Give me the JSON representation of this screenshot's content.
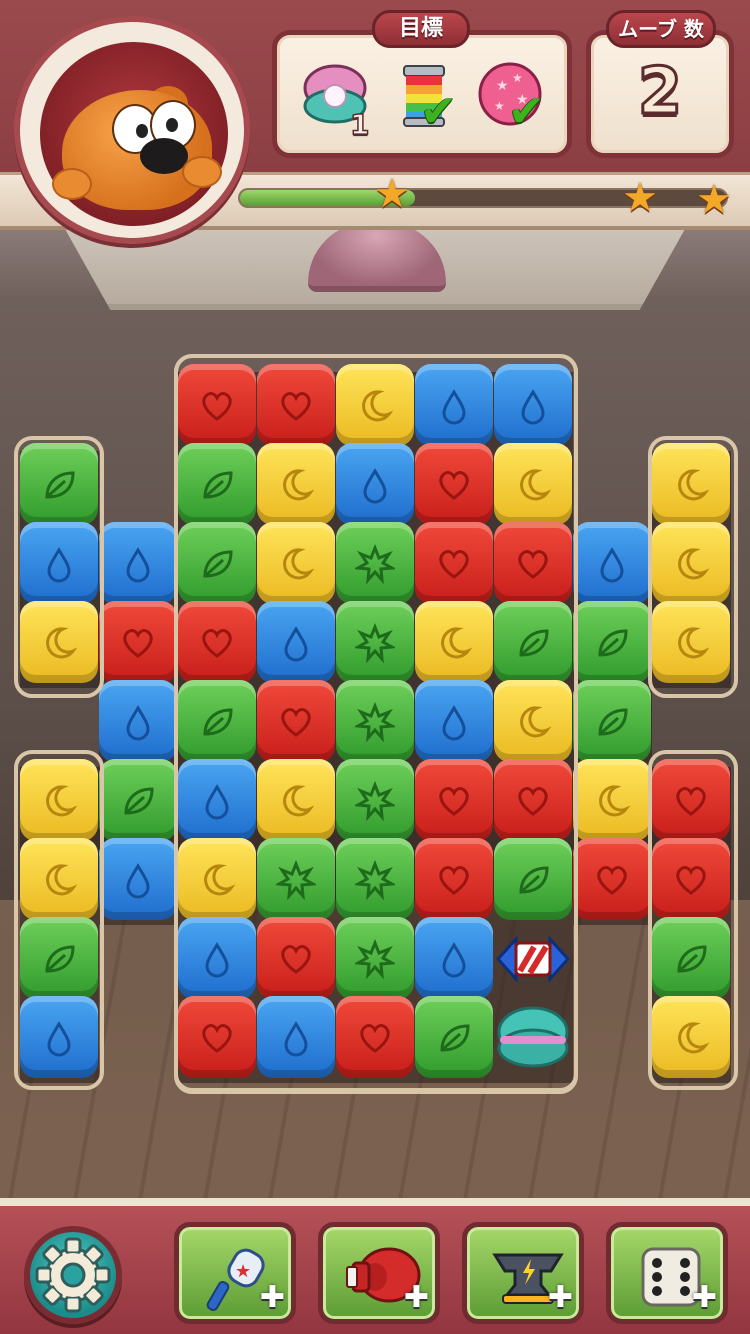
{
  "hud": {
    "goal_tab_label": "目標",
    "moves_tab_label": "ムーブ 数",
    "moves_value": "2",
    "goals": [
      {
        "icon": "pearl-clam-icon",
        "count": "1",
        "done": false
      },
      {
        "icon": "rainbow-paint-jar-icon",
        "done": true
      },
      {
        "icon": "pink-star-ball-icon",
        "done": true
      }
    ],
    "progress": 0.36,
    "stars": 3
  },
  "board": {
    "cols": 9,
    "rows": 9,
    "grid": [
      [
        "",
        "",
        "red",
        "red",
        "yellow",
        "blue",
        "blue",
        "",
        ""
      ],
      [
        "green",
        "",
        "green",
        "yellow",
        "blue",
        "red",
        "yellow",
        "",
        "yellow"
      ],
      [
        "blue",
        "blue",
        "green",
        "yellow",
        "green*",
        "red",
        "red",
        "blue",
        "yellow"
      ],
      [
        "yellow",
        "red",
        "red",
        "blue",
        "green*",
        "yellow",
        "green",
        "green",
        "yellow"
      ],
      [
        "",
        "blue",
        "green",
        "red",
        "green*",
        "blue",
        "yellow",
        "green",
        ""
      ],
      [
        "yellow",
        "green",
        "blue",
        "yellow",
        "green*",
        "red",
        "red",
        "yellow",
        "red"
      ],
      [
        "yellow",
        "blue",
        "yellow",
        "green*",
        "green*",
        "red",
        "green",
        "red",
        "red"
      ],
      [
        "green",
        "",
        "blue",
        "red",
        "green*",
        "blue",
        "rocket",
        "",
        "green"
      ],
      [
        "blue",
        "",
        "red",
        "blue",
        "red",
        "green",
        "clam",
        "",
        "yellow"
      ]
    ]
  },
  "boosters": [
    {
      "name": "rocket-hammer-booster",
      "icon": "rocket-hammer-icon"
    },
    {
      "name": "boxing-glove-booster",
      "icon": "boxing-glove-icon"
    },
    {
      "name": "anvil-booster",
      "icon": "anvil-icon"
    },
    {
      "name": "dice-booster",
      "icon": "dice-icon"
    }
  ],
  "colors": {
    "red": "#d82a22",
    "yellow": "#f2c62e",
    "blue": "#2d86df",
    "green": "#45b23b",
    "frame": "#8a3d41"
  }
}
